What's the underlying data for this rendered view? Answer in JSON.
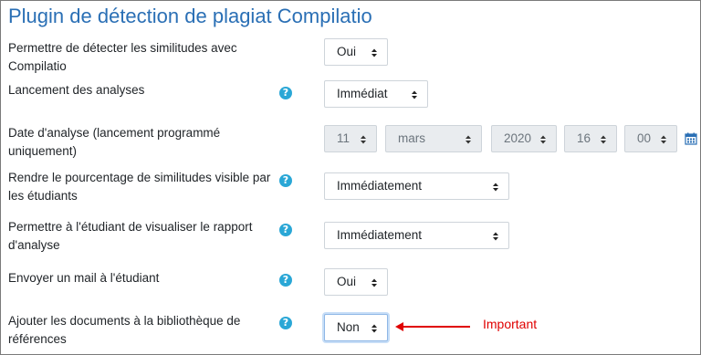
{
  "section_title": "Plugin de détection de plagiat Compilatio",
  "rows": [
    {
      "label": "Permettre de détecter les similitudes avec Compilatio",
      "value": "Oui"
    },
    {
      "label": "Lancement des analyses",
      "value": "Immédiat"
    },
    {
      "label": "Date d'analyse (lancement programmé uniquement)",
      "date": {
        "day": "11",
        "month": "mars",
        "year": "2020",
        "hour": "16",
        "minute": "00"
      }
    },
    {
      "label": "Rendre le pourcentage de similitudes visible par les étudiants",
      "value": "Immédiatement"
    },
    {
      "label": "Permettre à l'étudiant de visualiser le rapport d'analyse",
      "value": "Immédiatement"
    },
    {
      "label": "Envoyer un mail à l'étudiant",
      "value": "Oui"
    },
    {
      "label": "Ajouter les documents à la bibliothèque de références",
      "value": "Non"
    }
  ],
  "annotation": {
    "text": "Important",
    "color": "#e00000"
  },
  "icons": {
    "help": "help-icon",
    "calendar": "calendar-icon",
    "select_arrow": "select-arrow-icon"
  },
  "colors": {
    "title": "#2a6fb5",
    "help_icon": "#2aa7d6",
    "disabled_bg": "#e9ecef"
  }
}
